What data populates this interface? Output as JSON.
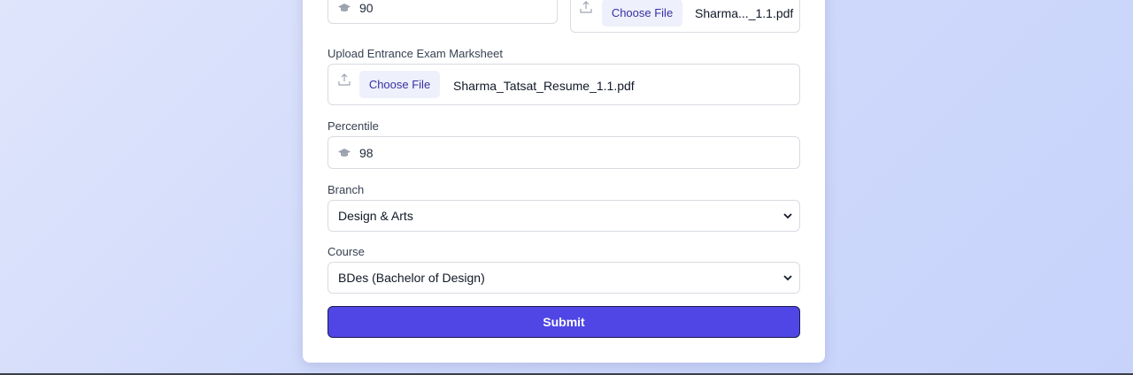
{
  "marks": {
    "field_value": "90",
    "marksheet_chosen_file": "Sharma..._1.1.pdf"
  },
  "entrance": {
    "label": "Upload Entrance Exam Marksheet",
    "choose_file_label": "Choose File",
    "chosen_file": "Sharma_Tatsat_Resume_1.1.pdf"
  },
  "percentile": {
    "label": "Percentile",
    "value": "98"
  },
  "branch": {
    "label": "Branch",
    "selected": "Design & Arts"
  },
  "course": {
    "label": "Course",
    "selected": "BDes (Bachelor of Design)"
  },
  "submit_label": "Submit",
  "colors": {
    "accent": "#4f46e5",
    "choose_button_bg": "#eef0fb",
    "choose_button_text": "#3730a3"
  }
}
